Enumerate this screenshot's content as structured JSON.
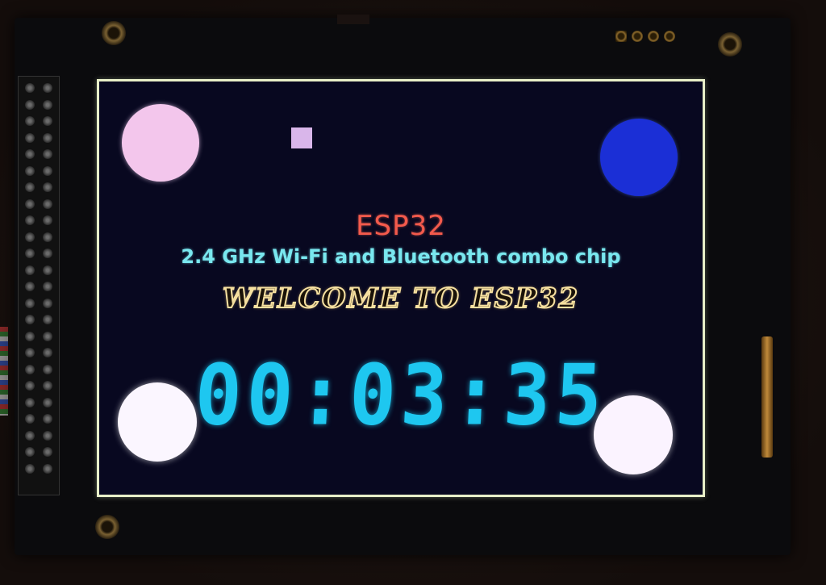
{
  "display": {
    "title": "ESP32",
    "subtitle": "2.4 GHz Wi-Fi and Bluetooth combo chip",
    "welcome": "WELCOME TO ESP32",
    "clock": "00:03:35"
  },
  "colors": {
    "title": "#f35a4c",
    "subtitle": "#79e7ef",
    "welcome_outline": "#f6e0a0",
    "clock": "#1ec7f0",
    "screen_border": "#e8efc8",
    "circle_top_left": "#f3c6ec",
    "circle_top_right": "#1b2fd6",
    "circle_bottom_left": "#fbf6ff",
    "circle_bottom_right": "#fbf3ff",
    "square": "#d9b6ea"
  }
}
